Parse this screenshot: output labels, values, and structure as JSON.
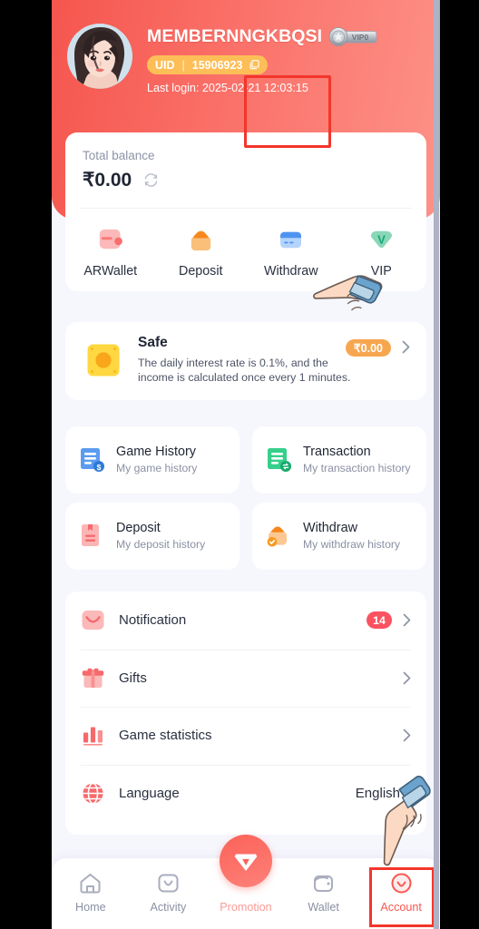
{
  "header": {
    "username": "MEMBERNNGKBQSI",
    "vip_label": "VIP0",
    "uid_label": "UID",
    "uid_separator": "|",
    "uid_value": "15906923",
    "last_login": "Last login: 2025-02-21 12:03:15",
    "gradient_from": "#f5564e",
    "gradient_to": "#fd9288",
    "uid_pill_color": "#fdbe57"
  },
  "balance": {
    "label": "Total balance",
    "amount": "₹0.00",
    "refresh_icon": "refresh-icon",
    "quick_actions": [
      {
        "label": "ARWallet",
        "icon": "wallet-icon",
        "color": "#f9a8a8",
        "highlighted": false
      },
      {
        "label": "Deposit",
        "icon": "deposit-bag-icon",
        "color": "#f9a94f",
        "highlighted": false
      },
      {
        "label": "Withdraw",
        "icon": "bank-card-icon",
        "color": "#5b9cf0",
        "highlighted": true
      },
      {
        "label": "VIP",
        "icon": "vip-diamond-icon",
        "color": "#7ad0b0",
        "highlighted": false
      }
    ],
    "highlight_color": "#f4352b"
  },
  "safe": {
    "title": "Safe",
    "description": "The daily interest rate is 0.1%, and the income is calculated once every 1 minutes.",
    "amount": "₹0.00",
    "icon": "safe-box-icon",
    "pill_color": "#f7a64f"
  },
  "history_cards": [
    {
      "title": "Game History",
      "subtitle": "My game history",
      "icon": "game-history-icon",
      "color": "#5b9cf0"
    },
    {
      "title": "Transaction",
      "subtitle": "My transaction history",
      "icon": "transaction-icon",
      "color": "#36cf8b"
    },
    {
      "title": "Deposit",
      "subtitle": "My deposit history",
      "icon": "deposit-record-icon",
      "color": "#f9a0a0"
    },
    {
      "title": "Withdraw",
      "subtitle": "My withdraw history",
      "icon": "withdraw-record-icon",
      "color": "#f9b470"
    }
  ],
  "menu": [
    {
      "label": "Notification",
      "icon": "mail-icon",
      "badge": "14",
      "value": ""
    },
    {
      "label": "Gifts",
      "icon": "gift-icon",
      "badge": "",
      "value": ""
    },
    {
      "label": "Game statistics",
      "icon": "bar-chart-icon",
      "badge": "",
      "value": ""
    },
    {
      "label": "Language",
      "icon": "globe-icon",
      "badge": "",
      "value": "English"
    }
  ],
  "badge_color": "#fa5260",
  "nav": {
    "items": [
      {
        "label": "Home",
        "icon": "home-icon",
        "active": false
      },
      {
        "label": "Activity",
        "icon": "activity-icon",
        "active": false
      },
      {
        "label": "Promotion",
        "icon": "promotion-diamond-icon",
        "active": false
      },
      {
        "label": "Wallet",
        "icon": "wallet-nav-icon",
        "active": false
      },
      {
        "label": "Account",
        "icon": "account-icon",
        "active": true
      }
    ],
    "active_color": "#fa5750",
    "inactive_color": "#8b90a3",
    "highlight_color": "#f4352b"
  },
  "cursors": [
    {
      "name": "pointing-hand-withdraw",
      "direction": "up-left"
    },
    {
      "name": "pointing-hand-account",
      "direction": "down"
    }
  ]
}
